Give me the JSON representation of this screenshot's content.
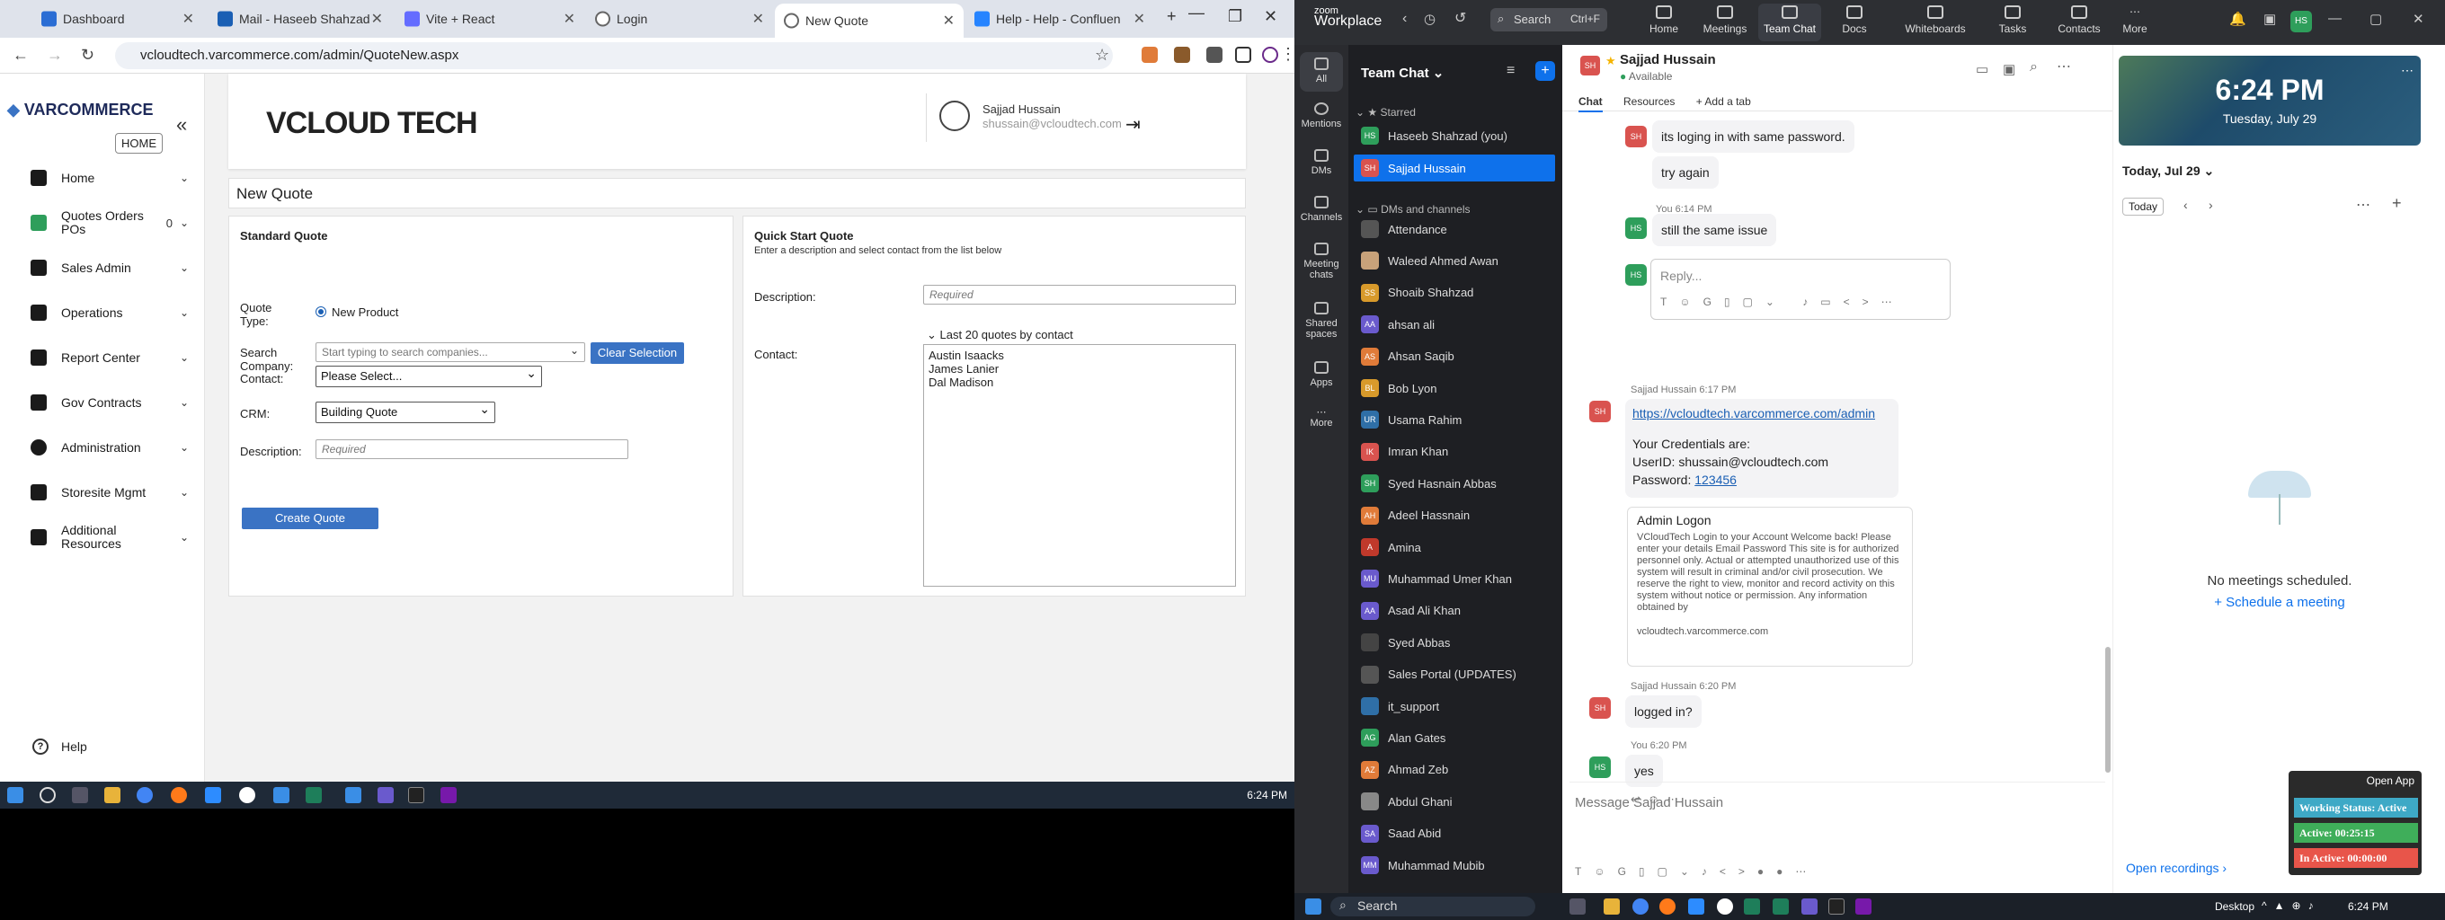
{
  "browser": {
    "tabs": [
      {
        "label": "Dashboard",
        "color": "#2a6dd4"
      },
      {
        "label": "Mail - Haseeb Shahzad",
        "color": "#1a5fb4"
      },
      {
        "label": "Vite + React",
        "color": "#646cff"
      },
      {
        "label": "Login",
        "color": "#666666"
      },
      {
        "label": "New Quote",
        "color": "#666666"
      },
      {
        "label": "Help - Help - Confluen",
        "color": "#2684ff"
      }
    ],
    "url": "vcloudtech.varcommerce.com/admin/QuoteNew.aspx"
  },
  "sidebar": {
    "logo": "VARCOMMERCE",
    "home_badge": "HOME",
    "items": [
      {
        "label": "Home"
      },
      {
        "label": "Quotes Orders POs",
        "badge": "0"
      },
      {
        "label": "Sales Admin"
      },
      {
        "label": "Operations"
      },
      {
        "label": "Report Center"
      },
      {
        "label": "Gov Contracts"
      },
      {
        "label": "Administration"
      },
      {
        "label": "Storesite Mgmt"
      },
      {
        "label": "Additional Resources"
      }
    ],
    "help": "Help"
  },
  "header": {
    "brand": "VCLOUD TECH",
    "user_name": "Sajjad Hussain",
    "user_email": "shussain@vcloudtech.com"
  },
  "page_title": "New Quote",
  "standard": {
    "title": "Standard Quote",
    "quote_type_label": "Quote Type:",
    "quote_type_value": "New Product",
    "search_company_label": "Search Company:",
    "search_placeholder": "Start typing to search companies...",
    "clear_button": "Clear Selection",
    "contact_label": "Contact:",
    "contact_value": "Please Select...",
    "crm_label": "CRM:",
    "crm_value": "Building Quote",
    "description_label": "Description:",
    "description_placeholder": "Required",
    "create_button": "Create Quote"
  },
  "quickstart": {
    "title": "Quick Start Quote",
    "subtitle": "Enter a description and select contact from the list below",
    "description_label": "Description:",
    "description_placeholder": "Required",
    "toggle": "Last 20 quotes by contact",
    "contact_label": "Contact:",
    "contacts": [
      "Austin Isaacks",
      "James Lanier",
      "Dal Madison"
    ]
  },
  "taskbar_time": "6:24 PM",
  "zoom": {
    "brand_top": "zoom",
    "brand": "Workplace",
    "search": "Search",
    "search_key": "Ctrl+F",
    "tabs": [
      "Home",
      "Meetings",
      "Team Chat",
      "Docs",
      "Whiteboards",
      "Tasks",
      "Contacts",
      "More"
    ],
    "rail": [
      "All",
      "Mentions",
      "DMs",
      "Channels",
      "Meeting chats",
      "Shared spaces",
      "Apps",
      "More"
    ],
    "list_title": "Team Chat",
    "starred": "Starred",
    "dms_channels": "DMs and channels",
    "starred_items": [
      {
        "name": "Haseeb Shahzad (you)",
        "initials": "HS",
        "color": "#2e9e5b"
      },
      {
        "name": "Sajjad Hussain",
        "initials": "SH",
        "color": "#d9534f"
      }
    ],
    "contacts": [
      {
        "name": "Attendance",
        "initials": "",
        "color": "#555555"
      },
      {
        "name": "Waleed Ahmed Awan",
        "initials": "",
        "color": "#c8a27a"
      },
      {
        "name": "Shoaib Shahzad",
        "initials": "SS",
        "color": "#d89a2b"
      },
      {
        "name": "ahsan ali",
        "initials": "AA",
        "color": "#6a5acd"
      },
      {
        "name": "Ahsan Saqib",
        "initials": "AS",
        "color": "#e07b39"
      },
      {
        "name": "Bob Lyon",
        "initials": "BL",
        "color": "#d89a2b"
      },
      {
        "name": "Usama Rahim",
        "initials": "UR",
        "color": "#2f6fa7"
      },
      {
        "name": "Imran Khan",
        "initials": "IK",
        "color": "#d9534f"
      },
      {
        "name": "Syed Hasnain Abbas",
        "initials": "SH",
        "color": "#2e9e5b"
      },
      {
        "name": "Adeel Hassnain",
        "initials": "AH",
        "color": "#e07b39"
      },
      {
        "name": "Amina",
        "initials": "A",
        "color": "#c0392b"
      },
      {
        "name": "Muhammad Umer Khan",
        "initials": "MU",
        "color": "#6a5acd"
      },
      {
        "name": "Asad Ali Khan",
        "initials": "AA",
        "color": "#6a5acd"
      },
      {
        "name": "Syed Abbas",
        "initials": "",
        "color": "#444444"
      },
      {
        "name": "Sales Portal (UPDATES)",
        "initials": "",
        "color": "#555555"
      },
      {
        "name": "it_support",
        "initials": "",
        "color": "#2f6fa7"
      },
      {
        "name": "Alan Gates",
        "initials": "AG",
        "color": "#2e9e5b"
      },
      {
        "name": "Ahmad Zeb",
        "initials": "AZ",
        "color": "#e07b39"
      },
      {
        "name": "Abdul Ghani",
        "initials": "",
        "color": "#888888"
      },
      {
        "name": "Saad Abid",
        "initials": "SA",
        "color": "#6a5acd"
      },
      {
        "name": "Muhammad Mubib",
        "initials": "MM",
        "color": "#6a5acd"
      }
    ],
    "chat_name": "Sajjad Hussain",
    "chat_status": "Available",
    "chat_tabs": [
      "Chat",
      "Resources",
      "+ Add a tab"
    ],
    "messages": {
      "m1": "its loging in with same password.",
      "m2": "try again",
      "m3_meta": "You 6:14 PM",
      "m3": "still the same issue",
      "reply_placeholder": "Reply...",
      "m4_meta": "Sajjad Hussain 6:17 PM",
      "m4_link": "https://vcloudtech.varcommerce.com/admin",
      "m4_cred": "Your Credentials are:",
      "m4_user": "UserID: shussain@vcloudtech.com",
      "m4_pass_label": "Password:",
      "m4_pass": "123456",
      "preview_title": "Admin Logon",
      "preview_body": "VCloudTech Login to your Account Welcome back! Please enter your details Email Password This site is for authorized personnel only. Actual or attempted unauthorized use of this system will result in criminal and/or civil prosecution. We reserve the right to view, monitor and record activity on this system without notice or permission. Any information obtained by",
      "preview_domain": "vcloudtech.varcommerce.com",
      "m5_meta": "Sajjad Hussain 6:20 PM",
      "m5": "logged in?",
      "m6_meta": "You 6:20 PM",
      "m6": "yes"
    },
    "compose_placeholder": "Message Sajjad Hussain",
    "clock_time": "6:24 PM",
    "clock_date": "Tuesday, July 29",
    "cal_date": "Today, Jul 29",
    "today_btn": "Today",
    "no_meetings": "No meetings scheduled.",
    "schedule": "Schedule a meeting",
    "open_recordings": "Open recordings",
    "open_app": "Open App",
    "working_status": "Working Status: Active",
    "active": "Active: 00:25:15",
    "inactive": "In Active: 00:00:00",
    "search_taskbar": "Search",
    "desktop": "Desktop",
    "time": "6:24 PM"
  }
}
